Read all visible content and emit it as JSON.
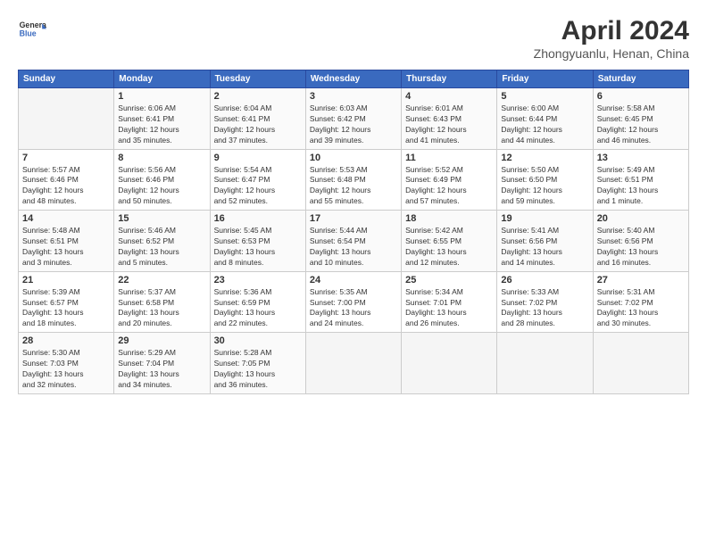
{
  "header": {
    "logo_line1": "General",
    "logo_line2": "Blue",
    "title": "April 2024",
    "subtitle": "Zhongyuanlu, Henan, China"
  },
  "days_of_week": [
    "Sunday",
    "Monday",
    "Tuesday",
    "Wednesday",
    "Thursday",
    "Friday",
    "Saturday"
  ],
  "weeks": [
    [
      {
        "num": "",
        "content": ""
      },
      {
        "num": "1",
        "content": "Sunrise: 6:06 AM\nSunset: 6:41 PM\nDaylight: 12 hours\nand 35 minutes."
      },
      {
        "num": "2",
        "content": "Sunrise: 6:04 AM\nSunset: 6:41 PM\nDaylight: 12 hours\nand 37 minutes."
      },
      {
        "num": "3",
        "content": "Sunrise: 6:03 AM\nSunset: 6:42 PM\nDaylight: 12 hours\nand 39 minutes."
      },
      {
        "num": "4",
        "content": "Sunrise: 6:01 AM\nSunset: 6:43 PM\nDaylight: 12 hours\nand 41 minutes."
      },
      {
        "num": "5",
        "content": "Sunrise: 6:00 AM\nSunset: 6:44 PM\nDaylight: 12 hours\nand 44 minutes."
      },
      {
        "num": "6",
        "content": "Sunrise: 5:58 AM\nSunset: 6:45 PM\nDaylight: 12 hours\nand 46 minutes."
      }
    ],
    [
      {
        "num": "7",
        "content": "Sunrise: 5:57 AM\nSunset: 6:46 PM\nDaylight: 12 hours\nand 48 minutes."
      },
      {
        "num": "8",
        "content": "Sunrise: 5:56 AM\nSunset: 6:46 PM\nDaylight: 12 hours\nand 50 minutes."
      },
      {
        "num": "9",
        "content": "Sunrise: 5:54 AM\nSunset: 6:47 PM\nDaylight: 12 hours\nand 52 minutes."
      },
      {
        "num": "10",
        "content": "Sunrise: 5:53 AM\nSunset: 6:48 PM\nDaylight: 12 hours\nand 55 minutes."
      },
      {
        "num": "11",
        "content": "Sunrise: 5:52 AM\nSunset: 6:49 PM\nDaylight: 12 hours\nand 57 minutes."
      },
      {
        "num": "12",
        "content": "Sunrise: 5:50 AM\nSunset: 6:50 PM\nDaylight: 12 hours\nand 59 minutes."
      },
      {
        "num": "13",
        "content": "Sunrise: 5:49 AM\nSunset: 6:51 PM\nDaylight: 13 hours\nand 1 minute."
      }
    ],
    [
      {
        "num": "14",
        "content": "Sunrise: 5:48 AM\nSunset: 6:51 PM\nDaylight: 13 hours\nand 3 minutes."
      },
      {
        "num": "15",
        "content": "Sunrise: 5:46 AM\nSunset: 6:52 PM\nDaylight: 13 hours\nand 5 minutes."
      },
      {
        "num": "16",
        "content": "Sunrise: 5:45 AM\nSunset: 6:53 PM\nDaylight: 13 hours\nand 8 minutes."
      },
      {
        "num": "17",
        "content": "Sunrise: 5:44 AM\nSunset: 6:54 PM\nDaylight: 13 hours\nand 10 minutes."
      },
      {
        "num": "18",
        "content": "Sunrise: 5:42 AM\nSunset: 6:55 PM\nDaylight: 13 hours\nand 12 minutes."
      },
      {
        "num": "19",
        "content": "Sunrise: 5:41 AM\nSunset: 6:56 PM\nDaylight: 13 hours\nand 14 minutes."
      },
      {
        "num": "20",
        "content": "Sunrise: 5:40 AM\nSunset: 6:56 PM\nDaylight: 13 hours\nand 16 minutes."
      }
    ],
    [
      {
        "num": "21",
        "content": "Sunrise: 5:39 AM\nSunset: 6:57 PM\nDaylight: 13 hours\nand 18 minutes."
      },
      {
        "num": "22",
        "content": "Sunrise: 5:37 AM\nSunset: 6:58 PM\nDaylight: 13 hours\nand 20 minutes."
      },
      {
        "num": "23",
        "content": "Sunrise: 5:36 AM\nSunset: 6:59 PM\nDaylight: 13 hours\nand 22 minutes."
      },
      {
        "num": "24",
        "content": "Sunrise: 5:35 AM\nSunset: 7:00 PM\nDaylight: 13 hours\nand 24 minutes."
      },
      {
        "num": "25",
        "content": "Sunrise: 5:34 AM\nSunset: 7:01 PM\nDaylight: 13 hours\nand 26 minutes."
      },
      {
        "num": "26",
        "content": "Sunrise: 5:33 AM\nSunset: 7:02 PM\nDaylight: 13 hours\nand 28 minutes."
      },
      {
        "num": "27",
        "content": "Sunrise: 5:31 AM\nSunset: 7:02 PM\nDaylight: 13 hours\nand 30 minutes."
      }
    ],
    [
      {
        "num": "28",
        "content": "Sunrise: 5:30 AM\nSunset: 7:03 PM\nDaylight: 13 hours\nand 32 minutes."
      },
      {
        "num": "29",
        "content": "Sunrise: 5:29 AM\nSunset: 7:04 PM\nDaylight: 13 hours\nand 34 minutes."
      },
      {
        "num": "30",
        "content": "Sunrise: 5:28 AM\nSunset: 7:05 PM\nDaylight: 13 hours\nand 36 minutes."
      },
      {
        "num": "",
        "content": ""
      },
      {
        "num": "",
        "content": ""
      },
      {
        "num": "",
        "content": ""
      },
      {
        "num": "",
        "content": ""
      }
    ]
  ]
}
